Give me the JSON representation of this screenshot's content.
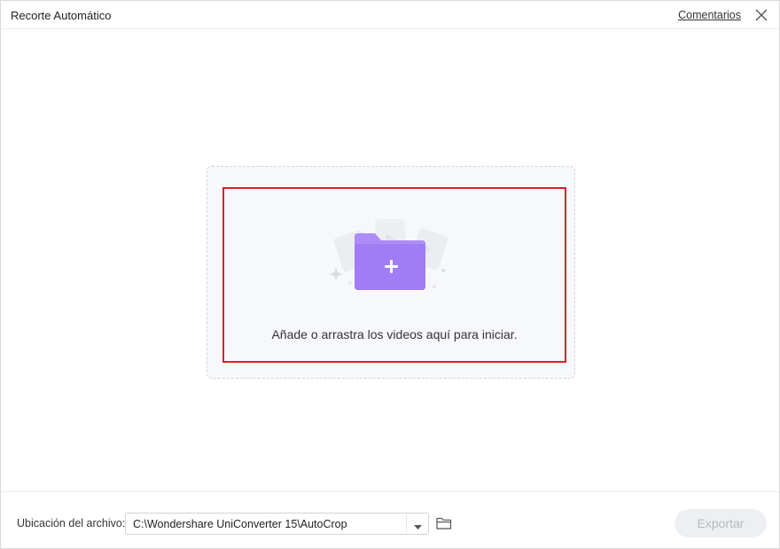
{
  "window": {
    "title": "Recorte Automático",
    "feedback_link": "Comentarios",
    "close_icon": "close-icon"
  },
  "dropzone": {
    "prompt": "Añade o arrastra los videos aquí para iniciar.",
    "icon": "add-folder-icon",
    "highlight_color": "#e01c2a"
  },
  "footer": {
    "location_label": "Ubicación del archivo:",
    "location_path": "C:\\Wondershare UniConverter 15\\AutoCrop",
    "dropdown_icon": "chevron-down-icon",
    "open_folder_icon": "folder-icon",
    "export_label": "Exportar",
    "export_enabled": false
  },
  "colors": {
    "accent": "#9f7bf6",
    "disabled_button": "#eeeff3"
  }
}
